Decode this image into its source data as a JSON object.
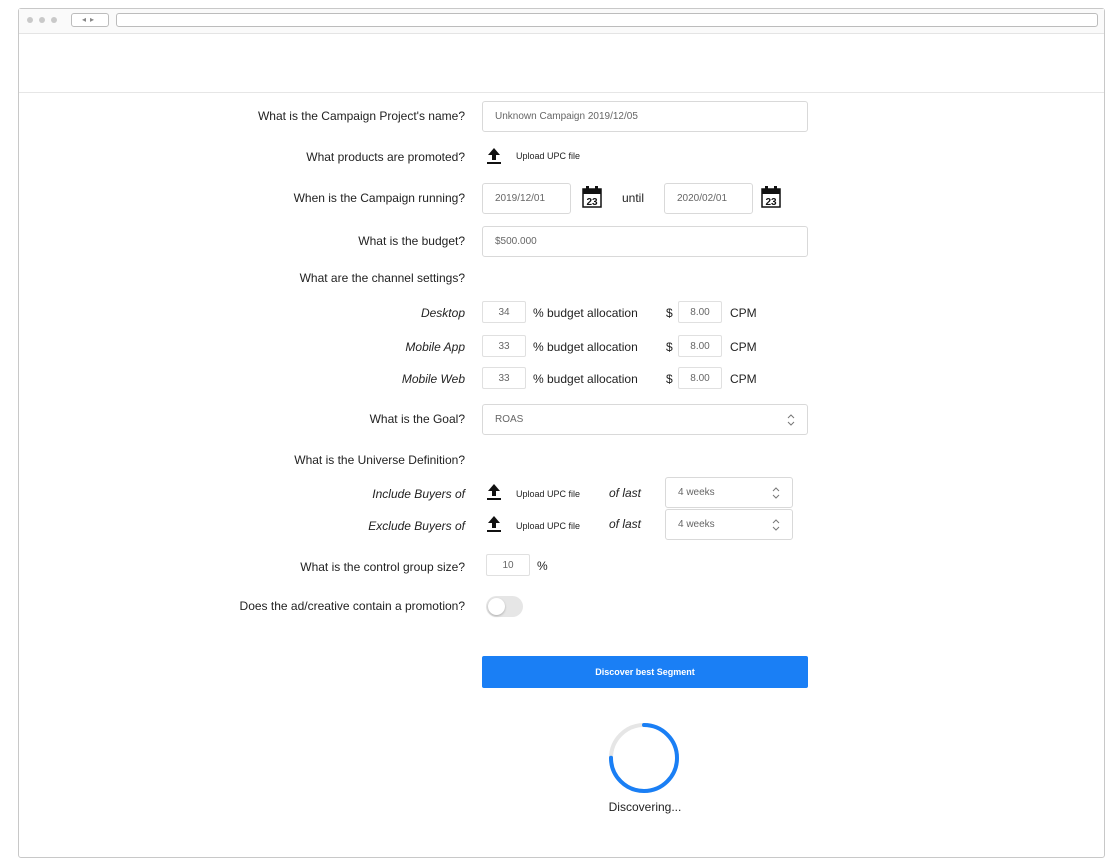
{
  "form": {
    "name": {
      "label": "What is the Campaign Project's name?",
      "value": "Unknown Campaign 2019/12/05"
    },
    "products": {
      "label": "What products are promoted?",
      "upload_label": "Upload UPC file"
    },
    "dates": {
      "label": "When is the Campaign running?",
      "start": "2019/12/01",
      "until_label": "until",
      "end": "2020/02/01",
      "calendar_day": "23"
    },
    "budget": {
      "label": "What is the budget?",
      "value": "$500.000"
    },
    "channels": {
      "label": "What are the channel settings?",
      "alloc_label": "% budget allocation",
      "currency": "$",
      "cpm_label": "CPM",
      "rows": [
        {
          "name": "Desktop",
          "allocation": "34",
          "cpm": "8.00"
        },
        {
          "name": "Mobile App",
          "allocation": "33",
          "cpm": "8.00"
        },
        {
          "name": "Mobile Web",
          "allocation": "33",
          "cpm": "8.00"
        }
      ]
    },
    "goal": {
      "label": "What is the Goal?",
      "value": "ROAS"
    },
    "universe": {
      "label": "What is the Universe Definition?",
      "rows": [
        {
          "label": "Include Buyers of",
          "upload_label": "Upload UPC file",
          "of_last_label": "of last",
          "period": "4 weeks"
        },
        {
          "label": "Exclude Buyers of",
          "upload_label": "Upload UPC file",
          "of_last_label": "of last",
          "period": "4 weeks"
        }
      ]
    },
    "control_group": {
      "label": "What is the control group size?",
      "value": "10",
      "unit": "%"
    },
    "promotion": {
      "label": "Does the ad/creative contain a promotion?",
      "enabled": false
    },
    "submit_label": "Discover best Segment",
    "status_text": "Discovering...",
    "spinner_progress": 0.75
  },
  "colors": {
    "accent": "#1a7ff5",
    "toggle_off": "#e6e6e6",
    "border": "#d9d9d9"
  },
  "icons": [
    "upload-icon",
    "calendar-icon",
    "select-arrows-icon",
    "loading-spinner"
  ]
}
